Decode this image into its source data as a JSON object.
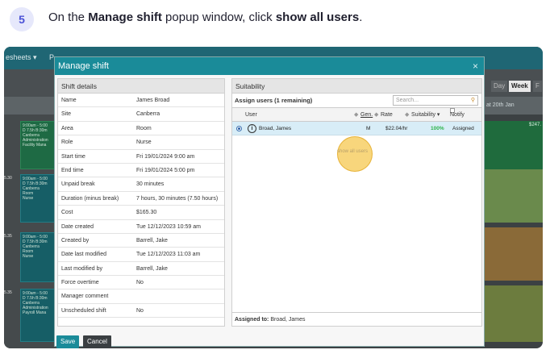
{
  "step": {
    "number": "5",
    "text_prefix": "On the ",
    "text_bold1": "Manage shift",
    "text_mid": " popup window, click ",
    "text_bold2": "show all users",
    "text_suffix": "."
  },
  "app": {
    "nav_left": "esheets ▾",
    "nav_second": "P",
    "views": [
      "Day",
      "Week",
      "F"
    ],
    "date_header": "at 20th Jan",
    "right_amount": "$247."
  },
  "background_shifts": [
    {
      "time_tag": "",
      "lines": [
        "9:00am - 5:00",
        "D 7.5h B:30m",
        "Canberra",
        "Administration",
        "Facility Mana"
      ]
    },
    {
      "time_tag": "5.30",
      "lines": [
        "9:00am - 5:00",
        "D 7.5h B:30m",
        "Canberra",
        "Room",
        "Nurse"
      ]
    },
    {
      "time_tag": "5.35",
      "lines": [
        "9:00am - 5:00",
        "D 7.5h B:30m",
        "Canberra",
        "Room",
        "Nurse"
      ]
    },
    {
      "time_tag": "5.35",
      "lines": [
        "9:00am - 5:00",
        "D 7.5h B:30m",
        "Canberra",
        "Administration",
        "Payroll Mana"
      ]
    }
  ],
  "modal": {
    "title": "Manage shift",
    "close_glyph": "×",
    "shift_details": {
      "heading": "Shift details",
      "rows": [
        {
          "k": "Name",
          "v": "James Broad"
        },
        {
          "k": "Site",
          "v": "Canberra"
        },
        {
          "k": "Area",
          "v": "Room"
        },
        {
          "k": "Role",
          "v": "Nurse"
        },
        {
          "k": "Start time",
          "v": "Fri 19/01/2024 9:00 am"
        },
        {
          "k": "End time",
          "v": "Fri 19/01/2024 5:00 pm"
        },
        {
          "k": "Unpaid break",
          "v": "30 minutes"
        },
        {
          "k": "Duration (minus break)",
          "v": "7 hours, 30 minutes (7.50 hours)"
        },
        {
          "k": "Cost",
          "v": "$165.30"
        },
        {
          "k": "Date created",
          "v": "Tue 12/12/2023 10:59 am"
        },
        {
          "k": "Created by",
          "v": "Barrell, Jake"
        },
        {
          "k": "Date last modified",
          "v": "Tue 12/12/2023 11:03 am"
        },
        {
          "k": "Last modified by",
          "v": "Barrell, Jake"
        },
        {
          "k": "Force overtime",
          "v": "No"
        },
        {
          "k": "Manager comment",
          "v": ""
        },
        {
          "k": "Unscheduled shift",
          "v": "No"
        }
      ]
    },
    "suitability": {
      "heading": "Suitability",
      "assign_label": "Assign users (1 remaining)",
      "search_placeholder": "Search...",
      "columns": {
        "user": "User",
        "gen": "Gen.",
        "rate": "Rate",
        "suitability": "Suitability ▾",
        "notify": "Notify"
      },
      "row": {
        "user": "Broad, James",
        "gen": "M",
        "rate": "$22.04/hr",
        "suitability": "100%",
        "status": "Assigned"
      },
      "show_all_link": "show all users",
      "assigned_to_label": "Assigned to:",
      "assigned_to_value": "Broad, James"
    },
    "buttons": {
      "save": "Save",
      "cancel": "Cancel"
    }
  },
  "colors": {
    "accent": "#1a8b99",
    "step_badge": "#4b52d6",
    "highlight": "#f5c850",
    "suitability_green": "#2cb34a"
  }
}
